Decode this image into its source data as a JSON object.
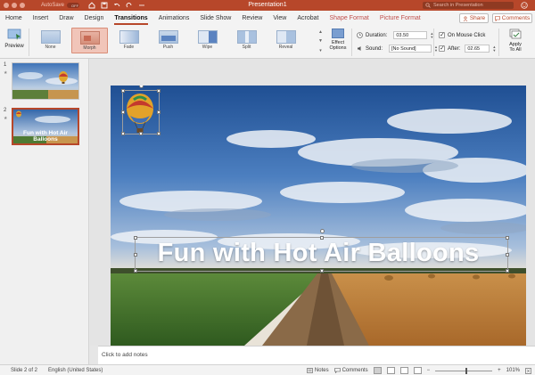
{
  "window": {
    "title": "Presentation1",
    "autosave_label": "AutoSave",
    "autosave_state": "OFF",
    "search_placeholder": "Search in Presentation"
  },
  "tabs": [
    {
      "label": "Home"
    },
    {
      "label": "Insert"
    },
    {
      "label": "Draw"
    },
    {
      "label": "Design"
    },
    {
      "label": "Transitions",
      "active": true
    },
    {
      "label": "Animations"
    },
    {
      "label": "Slide Show"
    },
    {
      "label": "Review"
    },
    {
      "label": "View"
    },
    {
      "label": "Acrobat"
    },
    {
      "label": "Shape Format",
      "contextual": true
    },
    {
      "label": "Picture Format",
      "contextual": true
    }
  ],
  "share_label": "Share",
  "comments_label": "Comments",
  "ribbon": {
    "preview_label": "Preview",
    "transitions": [
      {
        "label": "None"
      },
      {
        "label": "Morph",
        "selected": true
      },
      {
        "label": "Fade"
      },
      {
        "label": "Push"
      },
      {
        "label": "Wipe"
      },
      {
        "label": "Split"
      },
      {
        "label": "Reveal"
      }
    ],
    "effect_options_label": "Effect\nOptions",
    "effect_options_line1": "Effect",
    "effect_options_line2": "Options",
    "duration_label": "Duration:",
    "duration_value": "03.50",
    "sound_label": "Sound:",
    "sound_value": "[No Sound]",
    "on_mouse_click_label": "On Mouse Click",
    "after_label": "After:",
    "after_value": "02.65",
    "apply_line1": "Apply",
    "apply_line2": "To All"
  },
  "thumbnails": [
    {
      "number": "1",
      "star": "★",
      "title": ""
    },
    {
      "number": "2",
      "star": "★",
      "title": "Fun with Hot Air Balloons"
    }
  ],
  "slide": {
    "title": "Fun with Hot Air Balloons"
  },
  "notes_placeholder": "Click to add notes",
  "status": {
    "slide_info": "Slide 2 of 2",
    "language": "English (United States)",
    "notes_label": "Notes",
    "comments_label": "Comments",
    "zoom": "101%"
  },
  "colors": {
    "accent": "#b7472a",
    "selected_transition": "#f1c5b9"
  }
}
